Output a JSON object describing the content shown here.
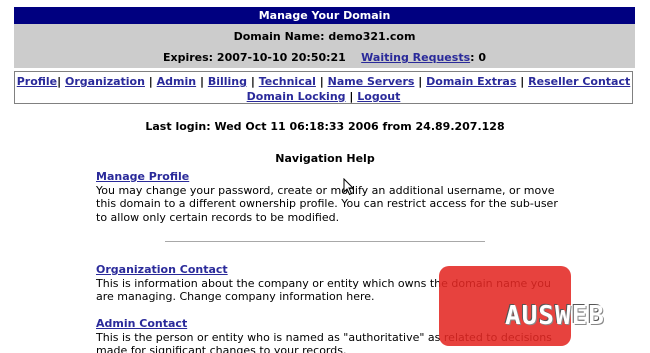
{
  "header": {
    "title": "Manage Your Domain",
    "domain_label": "Domain Name:",
    "domain_value": "demo321.com",
    "expires_label": "Expires:",
    "expires_value": "2007-10-10 20:50:21",
    "waiting_link": "Waiting Requests",
    "waiting_count": ": 0"
  },
  "nav": {
    "items": [
      "Profile",
      "Organization",
      "Admin",
      "Billing",
      "Technical",
      "Name Servers",
      "Domain Extras",
      "Reseller Contact",
      "Domain Locking",
      "Logout"
    ],
    "separator": "|"
  },
  "last_login": "Last login: Wed Oct 11 06:18:33 2006 from 24.89.207.128",
  "help": {
    "title": "Navigation Help",
    "sections": [
      {
        "link": "Manage Profile",
        "desc": "You may change your password, create or modify an additional username, or move this domain to a different ownership profile. You can restrict access for the sub-user to allow only certain records to be modified."
      },
      {
        "link": "Organization Contact",
        "desc": "This is information about the company or entity which owns the domain name you are managing. Change company information here."
      },
      {
        "link": "Admin Contact",
        "desc": "This is the person or entity who is named as \"authoritative\" as related to decisions made for significant changes to your records."
      }
    ]
  },
  "watermark": {
    "text": "AUSWEB",
    "color": "#e42823"
  },
  "colors": {
    "title_bg": "#000080",
    "info_bg": "#cccccc",
    "link": "#2a2a9a"
  }
}
